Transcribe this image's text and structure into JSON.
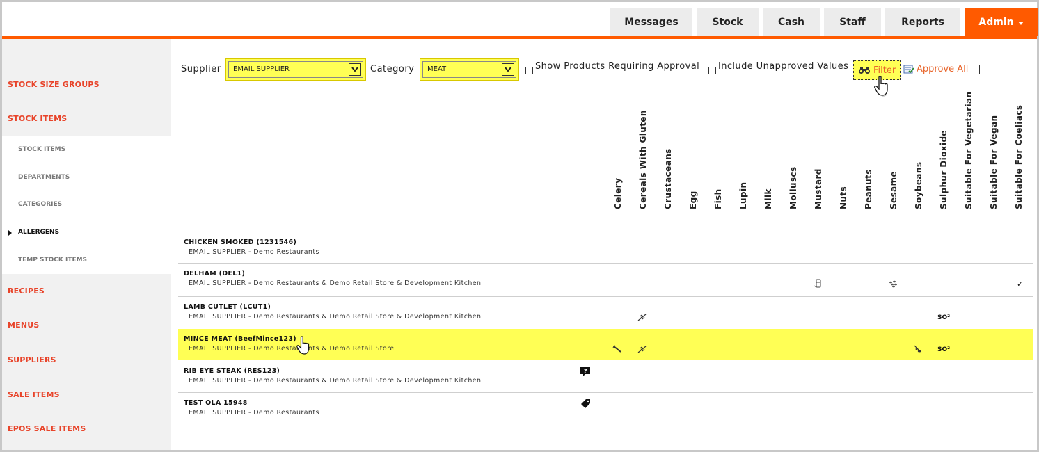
{
  "nav": {
    "items": [
      {
        "label": "Messages",
        "name": "nav-messages"
      },
      {
        "label": "Stock",
        "name": "nav-stock"
      },
      {
        "label": "Cash",
        "name": "nav-cash"
      },
      {
        "label": "Staff",
        "name": "nav-staff"
      },
      {
        "label": "Reports",
        "name": "nav-reports"
      }
    ],
    "admin_label": "Admin"
  },
  "sidebar": {
    "stock_size_groups": "STOCK SIZE GROUPS",
    "stock_items": "STOCK ITEMS",
    "sub": {
      "stock_items": "STOCK ITEMS",
      "departments": "DEPARTMENTS",
      "categories": "CATEGORIES",
      "allergens": "ALLERGENS",
      "temp_stock_items": "TEMP STOCK ITEMS"
    },
    "recipes": "RECIPES",
    "menus": "MENUS",
    "suppliers": "SUPPLIERS",
    "sale_items": "SALE ITEMS",
    "epos_sale_items": "EPOS SALE ITEMS"
  },
  "filters": {
    "supplier_label": "Supplier",
    "supplier_value": "EMAIL SUPPLIER",
    "category_label": "Category",
    "category_value": "MEAT",
    "show_requiring_approval": "Show Products Requiring Approval",
    "include_unapproved": "Include Unapproved Values",
    "filter_label": "Filter",
    "approve_all_label": "Approve All"
  },
  "columns": [
    "Celery",
    "Cereals With Gluten",
    "Crustaceans",
    "Egg",
    "Fish",
    "Lupin",
    "Milk",
    "Molluscs",
    "Mustard",
    "Nuts",
    "Peanuts",
    "Sesame",
    "Soybeans",
    "Sulphur Dioxide",
    "Suitable For Vegetarian",
    "Suitable For Vegan",
    "Suitable For Coeliacs"
  ],
  "rows": [
    {
      "name": "CHICKEN SMOKED (1231546)",
      "sub": "EMAIL SUPPLIER - Demo Restaurants"
    },
    {
      "name": "DELHAM (DEL1)",
      "sub": "EMAIL SUPPLIER - Demo Restaurants & Demo Retail Store & Development Kitchen"
    },
    {
      "name": "LAMB CUTLET (LCUT1)",
      "sub": "EMAIL SUPPLIER - Demo Restaurants & Demo Retail Store & Development Kitchen"
    },
    {
      "name": "MINCE MEAT (BeefMince123)",
      "sub": "EMAIL SUPPLIER - Demo Restaurants & Demo Retail Store"
    },
    {
      "name": "RIB EYE STEAK (RES123)",
      "sub": "EMAIL SUPPLIER - Demo Restaurants & Demo Retail Store & Development Kitchen"
    },
    {
      "name": "TEST OLA 15948",
      "sub": "EMAIL SUPPLIER - Demo Restaurants"
    }
  ],
  "cells": {
    "so2": "SO²",
    "check": "✓"
  },
  "colors": {
    "accent": "#ff5a00",
    "highlight": "#ffff55",
    "link": "#e8442a"
  }
}
